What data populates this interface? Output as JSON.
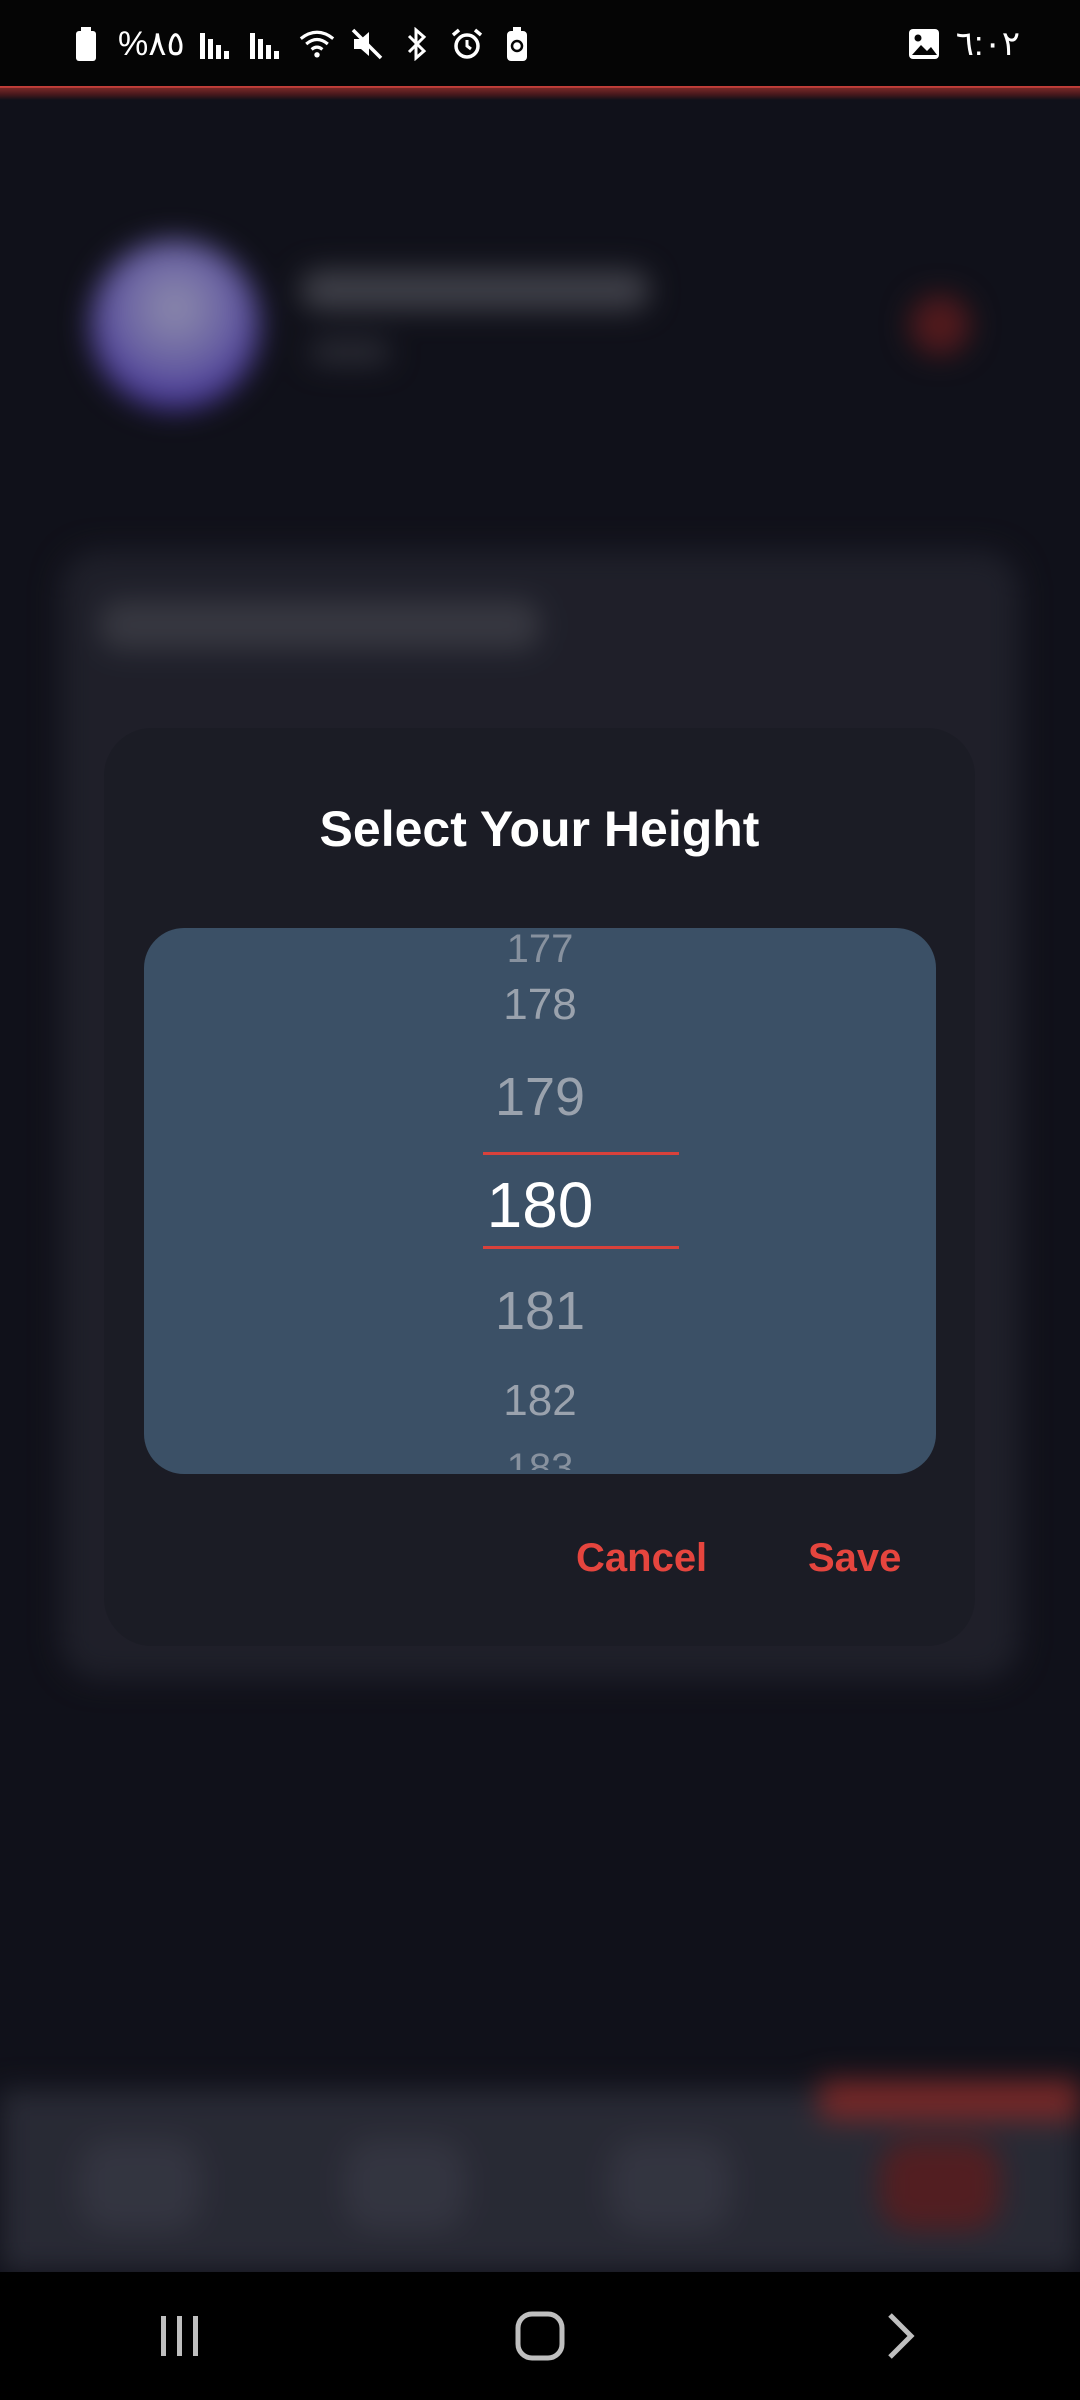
{
  "status_bar": {
    "battery": "%٨٥",
    "time": "٦:٠٢",
    "icons_left": [
      "battery-icon",
      "signal-icon",
      "signal-icon",
      "wifi-icon",
      "mute-icon",
      "bluetooth-icon",
      "alarm-icon",
      "battery-saver-icon"
    ],
    "icons_right": [
      "image-icon"
    ]
  },
  "dialog": {
    "title": "Select Your Height",
    "picker": {
      "partial_above": "177",
      "items_above": [
        "178",
        "179"
      ],
      "selected": "180",
      "items_below": [
        "181",
        "182"
      ],
      "partial_below": "183"
    },
    "cancel_label": "Cancel",
    "save_label": "Save"
  },
  "colors": {
    "accent": "#e5453e",
    "dialog_bg": "#1b1c25",
    "picker_bg": "#3b5066",
    "page_bg": "#15161f"
  },
  "system_nav": {
    "icons": [
      "recent-apps-icon",
      "home-icon",
      "back-icon"
    ]
  }
}
